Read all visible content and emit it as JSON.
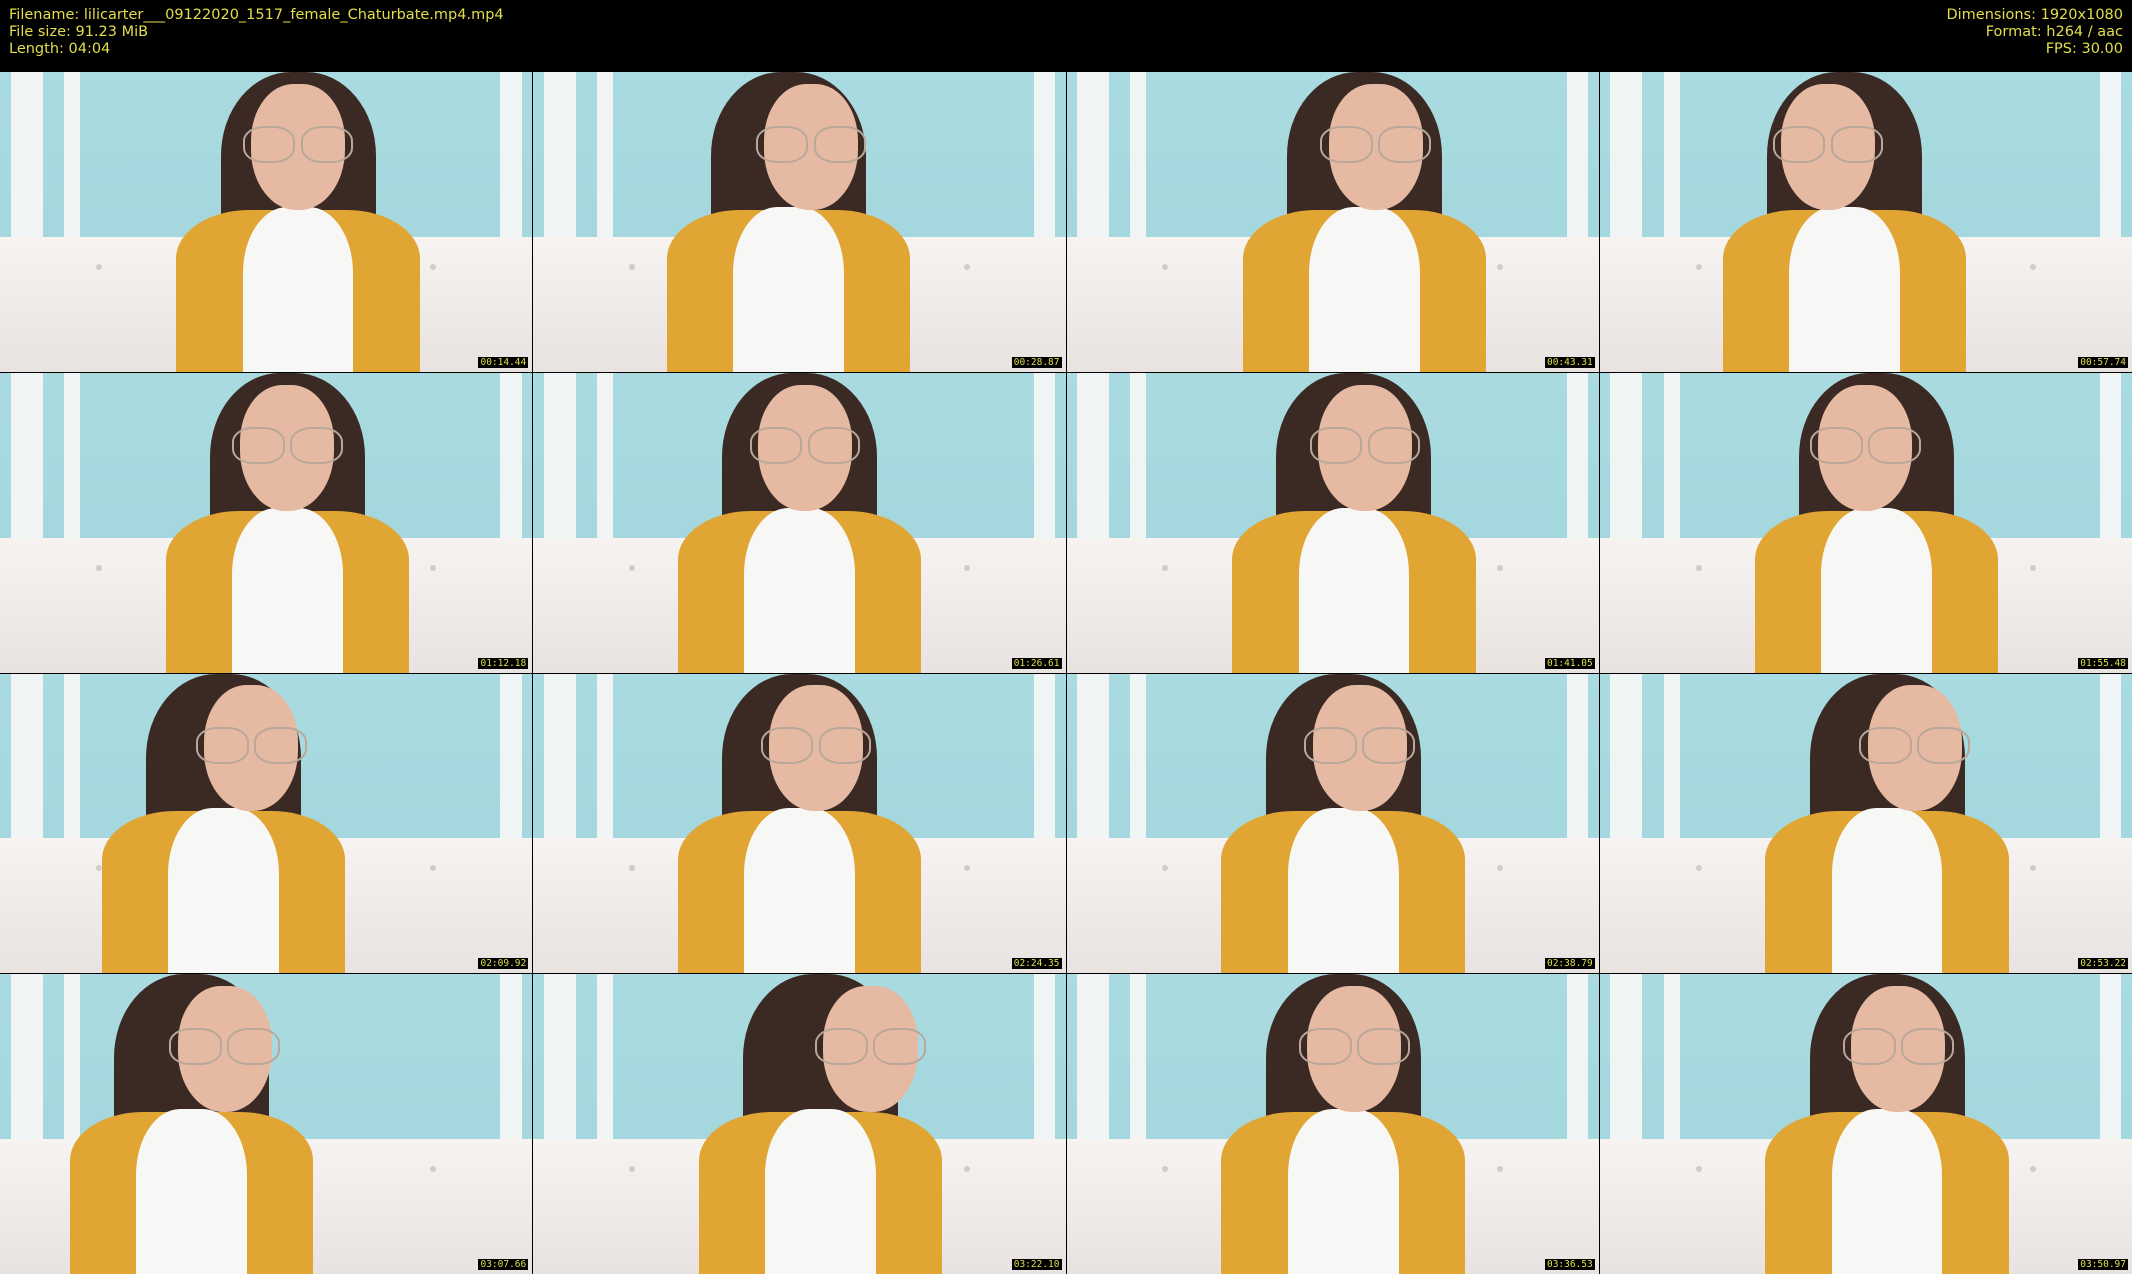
{
  "header": {
    "filename_label": "Filename: lilicarter___09122020_1517_female_Chaturbate.mp4.mp4",
    "filesize_label": "File size: 91.23 MiB",
    "length_label": "Length: 04:04",
    "dimensions_label": "Dimensions: 1920x1080",
    "format_label": "Format: h264 / aac",
    "fps_label": "FPS: 30.00"
  },
  "thumbnails": [
    {
      "timestamp": "00:14.44"
    },
    {
      "timestamp": "00:28.87"
    },
    {
      "timestamp": "00:43.31"
    },
    {
      "timestamp": "00:57.74"
    },
    {
      "timestamp": "01:12.18"
    },
    {
      "timestamp": "01:26.61"
    },
    {
      "timestamp": "01:41.05"
    },
    {
      "timestamp": "01:55.48"
    },
    {
      "timestamp": "02:09.92"
    },
    {
      "timestamp": "02:24.35"
    },
    {
      "timestamp": "02:38.79"
    },
    {
      "timestamp": "02:53.22"
    },
    {
      "timestamp": "03:07.66"
    },
    {
      "timestamp": "03:22.10"
    },
    {
      "timestamp": "03:36.53"
    },
    {
      "timestamp": "03:50.97"
    }
  ],
  "colors": {
    "text": "#e3df4a",
    "background": "#000000",
    "wall": "#a9dbe0",
    "cardigan": "#e0a533",
    "top": "#f7f7f5",
    "hair": "#3b2a24"
  }
}
